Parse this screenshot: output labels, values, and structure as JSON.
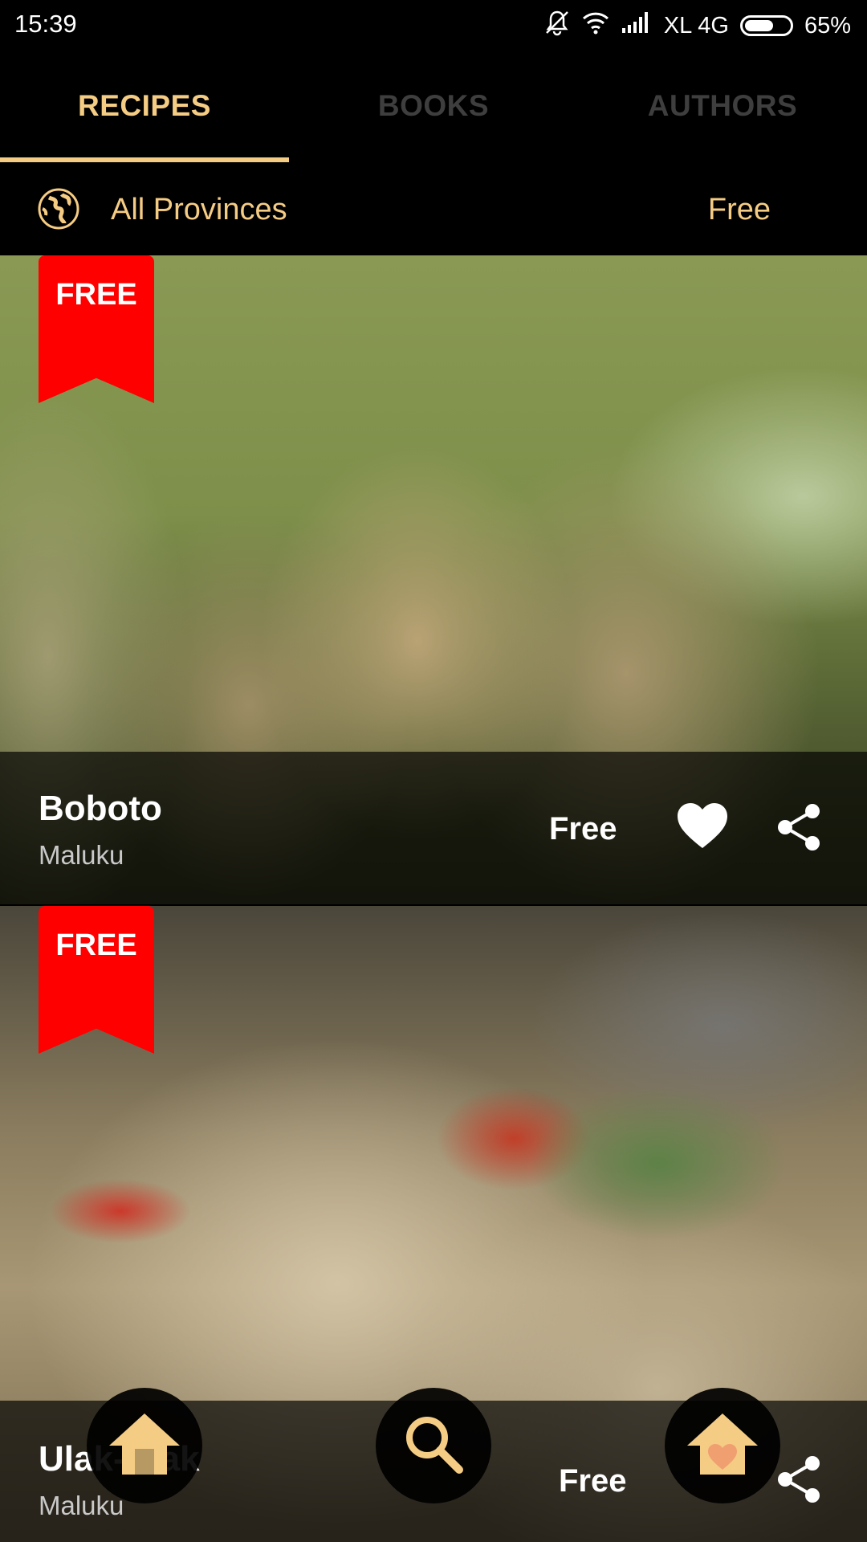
{
  "status_bar": {
    "time": "15:39",
    "carrier": "XL 4G",
    "battery_percent": "65%",
    "battery_level": 0.65,
    "icons": [
      "mute-icon",
      "wifi-icon",
      "signal-icon",
      "battery-icon"
    ]
  },
  "tabs": [
    {
      "label": "RECIPES",
      "active": true
    },
    {
      "label": "BOOKS",
      "active": false
    },
    {
      "label": "AUTHORS",
      "active": false
    }
  ],
  "filter": {
    "icon": "globe-icon",
    "province": "All Provinces",
    "price": "Free"
  },
  "recipes": [
    {
      "badge": "FREE",
      "name": "Boboto",
      "province": "Maluku",
      "price": "Free",
      "favorited": true
    },
    {
      "badge": "FREE",
      "name": "Ulak-Ulak",
      "province": "Maluku",
      "price": "Free",
      "favorited": true
    }
  ],
  "bottom_nav": {
    "items": [
      "home-icon",
      "search-icon",
      "favorites-home-icon"
    ]
  },
  "colors": {
    "accent": "#f5cc84",
    "inactive_tab": "#3e3e3e",
    "badge": "#ff0000",
    "background": "#000000"
  }
}
